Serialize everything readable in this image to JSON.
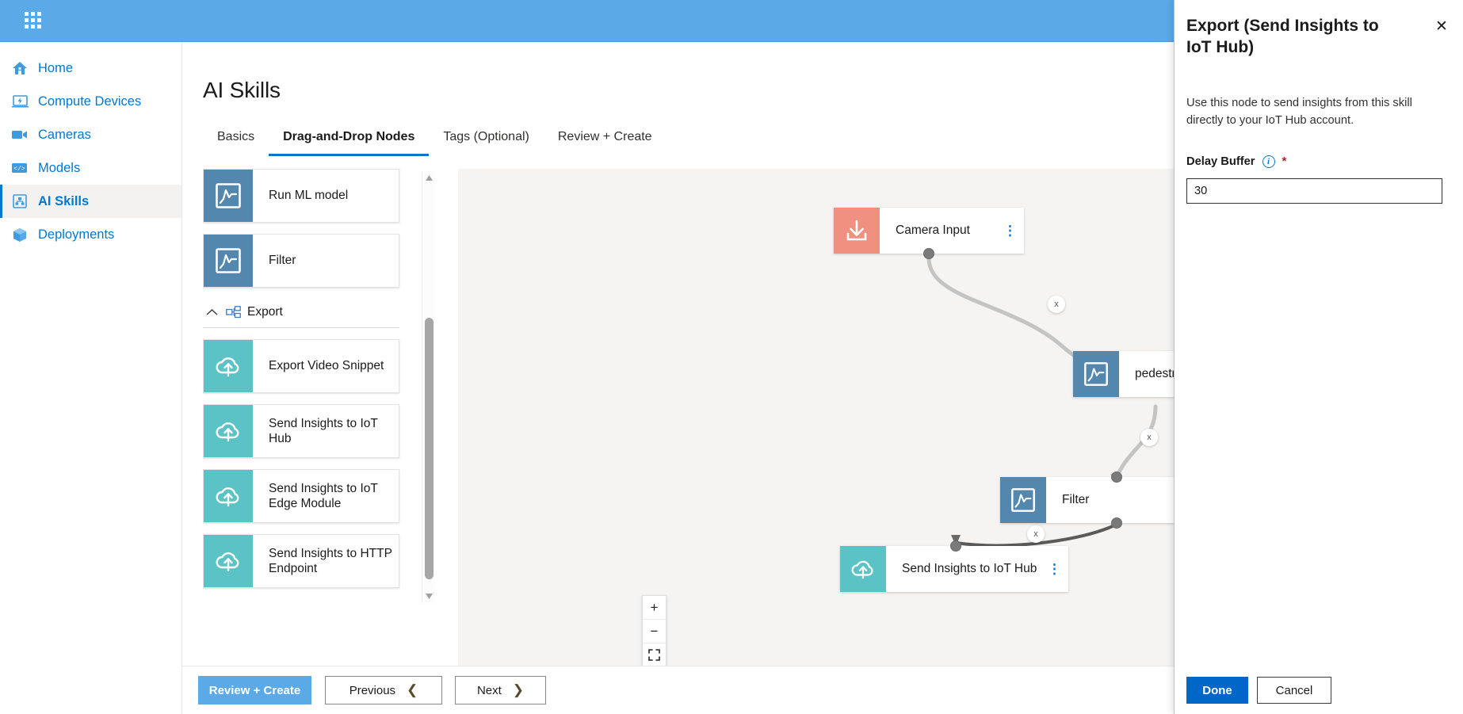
{
  "topbar": {
    "waffle_icon": "app-grid-icon"
  },
  "sidebar": {
    "items": [
      {
        "label": "Home",
        "icon": "home-icon",
        "active": false
      },
      {
        "label": "Compute Devices",
        "icon": "laptop-icon",
        "active": false
      },
      {
        "label": "Cameras",
        "icon": "camera-icon",
        "active": false
      },
      {
        "label": "Models",
        "icon": "code-icon",
        "active": false
      },
      {
        "label": "AI Skills",
        "icon": "skills-icon",
        "active": true
      },
      {
        "label": "Deployments",
        "icon": "cube-icon",
        "active": false
      }
    ]
  },
  "main": {
    "title": "AI Skills",
    "tabs": [
      {
        "label": "Basics",
        "active": false
      },
      {
        "label": "Drag-and-Drop Nodes",
        "active": true
      },
      {
        "label": "Tags (Optional)",
        "active": false
      },
      {
        "label": "Review + Create",
        "active": false
      }
    ]
  },
  "palette": {
    "cards_top": [
      {
        "label": "Run ML model",
        "color": "blue",
        "icon": "ml-chart-icon"
      },
      {
        "label": "Filter",
        "color": "blue",
        "icon": "ml-chart-icon"
      }
    ],
    "group": {
      "label": "Export",
      "icon": "export-group-icon",
      "chevron": "chevron-up-icon",
      "expanded": true
    },
    "cards_export": [
      {
        "label": "Export Video Snippet",
        "color": "teal",
        "icon": "cloud-upload-icon"
      },
      {
        "label": "Send Insights to IoT Hub",
        "color": "teal",
        "icon": "cloud-upload-icon"
      },
      {
        "label": "Send Insights to IoT Edge Module",
        "color": "teal",
        "icon": "cloud-upload-icon"
      },
      {
        "label": "Send Insights to HTTP Endpoint",
        "color": "teal",
        "icon": "cloud-upload-icon"
      }
    ]
  },
  "canvas": {
    "nodes": [
      {
        "label": "Camera Input",
        "color": "salmon",
        "icon": "download-arrow-icon",
        "menu": true
      },
      {
        "label": "pedestrian",
        "color": "blue",
        "icon": "ml-chart-icon",
        "menu": false
      },
      {
        "label": "Filter",
        "color": "blue",
        "icon": "ml-chart-icon",
        "menu": false
      },
      {
        "label": "Send Insights to IoT Hub",
        "color": "teal",
        "icon": "cloud-upload-icon",
        "menu": true
      }
    ],
    "edge_delete_label": "x",
    "zoom_controls": [
      {
        "icon": "zoom-in-icon",
        "glyph": "+"
      },
      {
        "icon": "zoom-out-icon",
        "glyph": "−"
      },
      {
        "icon": "fit-to-screen-icon",
        "glyph": ""
      },
      {
        "icon": "lock-icon",
        "glyph": ""
      }
    ]
  },
  "footer": {
    "review_create": "Review + Create",
    "previous": "Previous",
    "next": "Next"
  },
  "panel": {
    "title": "Export (Send Insights to IoT Hub)",
    "close_icon": "close-icon",
    "description": "Use this node to send insights from this skill directly to your IoT Hub account.",
    "field_label": "Delay Buffer",
    "info_icon": "info-icon",
    "required_marker": "*",
    "delay_value": "30",
    "delay_placeholder": "",
    "done": "Done",
    "cancel": "Cancel"
  },
  "colors": {
    "topbar": "#5ca9e8",
    "accent": "#0078d4",
    "primary_button": "#0067c8",
    "node_blue": "#5387ae",
    "node_teal": "#5bc2c6",
    "node_salmon": "#f09080",
    "required_red": "#a4262c"
  }
}
